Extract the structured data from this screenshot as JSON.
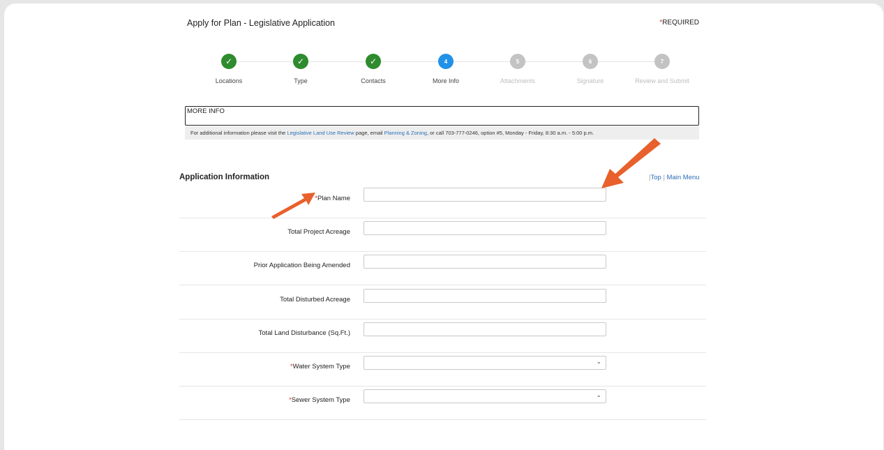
{
  "page": {
    "title": "Apply for Plan - Legislative Application",
    "required_star": "*",
    "required_label": "REQUIRED"
  },
  "stepper": {
    "steps": [
      {
        "label": "Locations",
        "state": "done",
        "icon": "check-icon"
      },
      {
        "label": "Type",
        "state": "done",
        "icon": "check-icon"
      },
      {
        "label": "Contacts",
        "state": "done",
        "icon": "check-icon"
      },
      {
        "label": "More Info",
        "state": "current",
        "number": "4"
      },
      {
        "label": "Attachments",
        "state": "todo",
        "number": "5"
      },
      {
        "label": "Signature",
        "state": "todo",
        "number": "6"
      },
      {
        "label": "Review and Submit",
        "state": "todo",
        "number": "7"
      }
    ]
  },
  "more_info": {
    "title": "MORE INFO",
    "text_1": "For additional information please visit the ",
    "link_1": "Legislative Land Use Review",
    "text_2": " page, email ",
    "link_2": "Planning & Zoning",
    "text_3": ", or call 703-777-0246, option #5, Monday - Friday, 8:30 a.m. - 5:00 p.m."
  },
  "section": {
    "title": "Application Information",
    "top_link": "Top",
    "menu_link": "Main Menu",
    "separator": "|"
  },
  "form": {
    "fields": [
      {
        "label": "Plan Name",
        "required": true,
        "type": "text",
        "value": ""
      },
      {
        "label": "Total Project Acreage",
        "required": false,
        "type": "text",
        "value": ""
      },
      {
        "label": "Prior Application Being Amended",
        "required": false,
        "type": "text",
        "value": ""
      },
      {
        "label": "Total Disturbed Acreage",
        "required": false,
        "type": "text",
        "value": ""
      },
      {
        "label": "Total Land Disturbance (Sq.Ft.)",
        "required": false,
        "type": "text",
        "value": ""
      },
      {
        "label": "Water System Type",
        "required": true,
        "type": "select",
        "value": ""
      },
      {
        "label": "Sewer System Type",
        "required": true,
        "type": "select",
        "value": ""
      }
    ]
  },
  "colors": {
    "accent": "#2191e8",
    "done": "#2e8b2e",
    "todo": "#c3c3c3",
    "required": "#d9352b",
    "annotation_arrow": "#e8602c"
  }
}
